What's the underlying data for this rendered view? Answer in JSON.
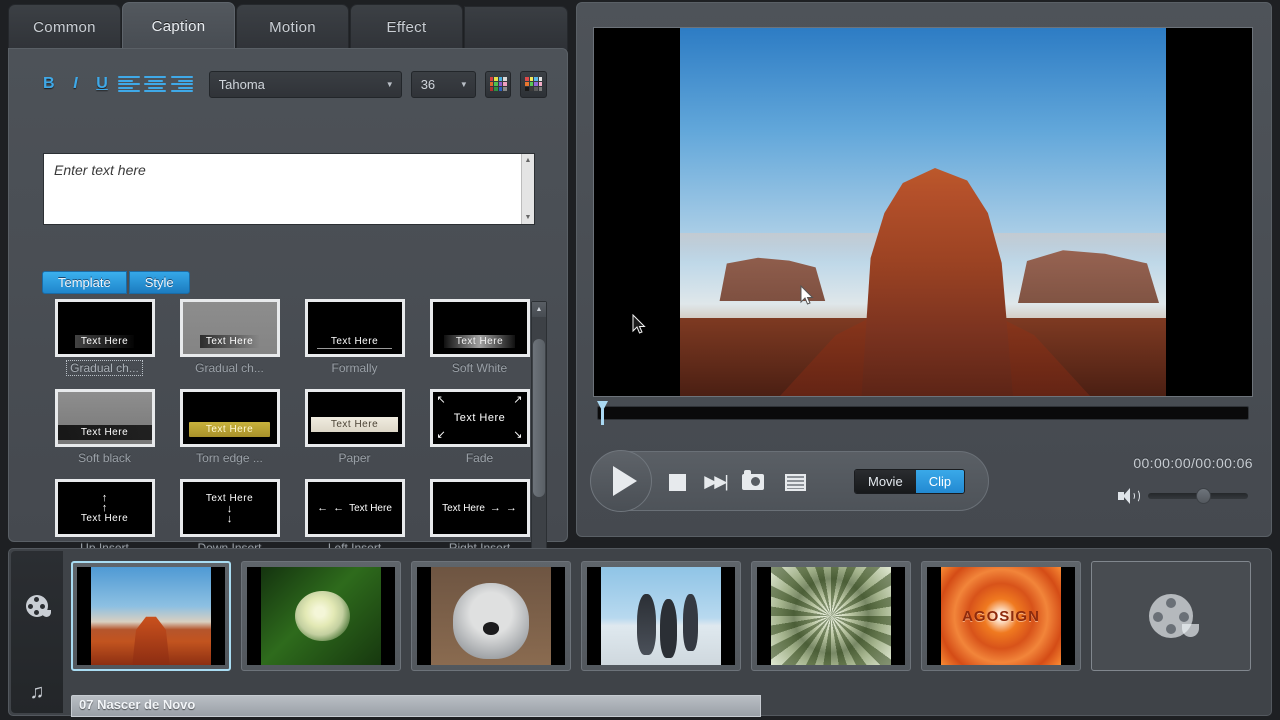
{
  "tabs": [
    {
      "label": "Common",
      "active": false
    },
    {
      "label": "Caption",
      "active": true
    },
    {
      "label": "Motion",
      "active": false
    },
    {
      "label": "Effect",
      "active": false
    }
  ],
  "format_toolbar": {
    "bold_label": "B",
    "italic_label": "I",
    "underline_label": "U",
    "align_left_icon": "align-left-icon",
    "align_center_icon": "align-center-icon",
    "align_right_icon": "align-right-icon",
    "font_family": "Tahoma",
    "font_size": "36",
    "caret_glyph": "▼",
    "text_color_icon": "text-color-palette-icon",
    "border_color_icon": "border-color-palette-icon"
  },
  "text_editor": {
    "placeholder": "Enter text here",
    "value": "",
    "scroll_up_glyph": "▲",
    "scroll_down_glyph": "▼"
  },
  "tpl_toggle": {
    "template_label": "Template",
    "style_label": "Style",
    "selected": "Template"
  },
  "templates": [
    {
      "label": "Gradual ch...",
      "variant": "v-grad-black",
      "text": "Text Here",
      "selected": true
    },
    {
      "label": "Gradual ch...",
      "variant": "v-grad-gray",
      "text": "Text Here",
      "selected": false
    },
    {
      "label": "Formally",
      "variant": "v-formally",
      "text": "Text Here",
      "selected": false
    },
    {
      "label": "Soft White",
      "variant": "v-softwhite",
      "text": "Text Here",
      "selected": false
    },
    {
      "label": "Soft black",
      "variant": "v-softblack",
      "text": "Text Here",
      "selected": false
    },
    {
      "label": "Torn edge ...",
      "variant": "v-torn",
      "text": "Text Here",
      "selected": false
    },
    {
      "label": "Paper",
      "variant": "v-paper",
      "text": "Text Here",
      "selected": false
    },
    {
      "label": "Fade",
      "variant": "v-fade",
      "text": "Text Here",
      "selected": false
    },
    {
      "label": "Up Insert",
      "variant": "v-up",
      "text": "Text Here",
      "selected": false
    },
    {
      "label": "Down Insert",
      "variant": "v-down",
      "text": "Text Here",
      "selected": false
    },
    {
      "label": "Left Insert",
      "variant": "v-left",
      "text": "Text Here",
      "selected": false
    },
    {
      "label": "Right Insert",
      "variant": "v-right",
      "text": "Text Here",
      "selected": false
    }
  ],
  "template_scrollbar": {
    "up_glyph": "▲",
    "down_glyph": "▼"
  },
  "player": {
    "play_icon": "play-icon",
    "stop_icon": "stop-icon",
    "next_frame_icon": "next-frame-icon",
    "snapshot_icon": "camera-snapshot-icon",
    "filmstrip_icon": "filmstrip-icon",
    "movie_label": "Movie",
    "clip_label": "Clip",
    "active_mode": "Clip",
    "timecode": "00:00:00/00:00:06",
    "speaker_icon": "speaker-volume-icon",
    "volume_percent": 50,
    "playhead_position_percent": 0,
    "accent_color": "#2e9ae0",
    "playhead_color": "#a9d8f2"
  },
  "timeline": {
    "video_track_icon": "film-reel-icon",
    "audio_track_icon": "music-note-icon",
    "clips": [
      {
        "name": "monument-valley-mesa",
        "art": "pic-mesa",
        "selected": true
      },
      {
        "name": "hydrangea-flower",
        "art": "pic-flower",
        "selected": false
      },
      {
        "name": "koala-bear",
        "art": "pic-koala",
        "selected": false
      },
      {
        "name": "penguins",
        "art": "pic-penguin",
        "selected": false
      },
      {
        "name": "green-kaleidoscope",
        "art": "pic-kaleido",
        "selected": false
      },
      {
        "name": "orange-agosign",
        "art": "pic-orange",
        "watermark": "AGOSIGN",
        "selected": false
      }
    ],
    "empty_slot_icon": "film-reel-placeholder-icon",
    "audio_clip_label": "07 Nascer de Novo"
  },
  "theme": {
    "panel_bg": "#494d52",
    "window_bg": "#1e2023",
    "accent_blue": "#2e9ae0",
    "text_primary": "#e9edf1",
    "text_muted": "#9aa0a7"
  }
}
